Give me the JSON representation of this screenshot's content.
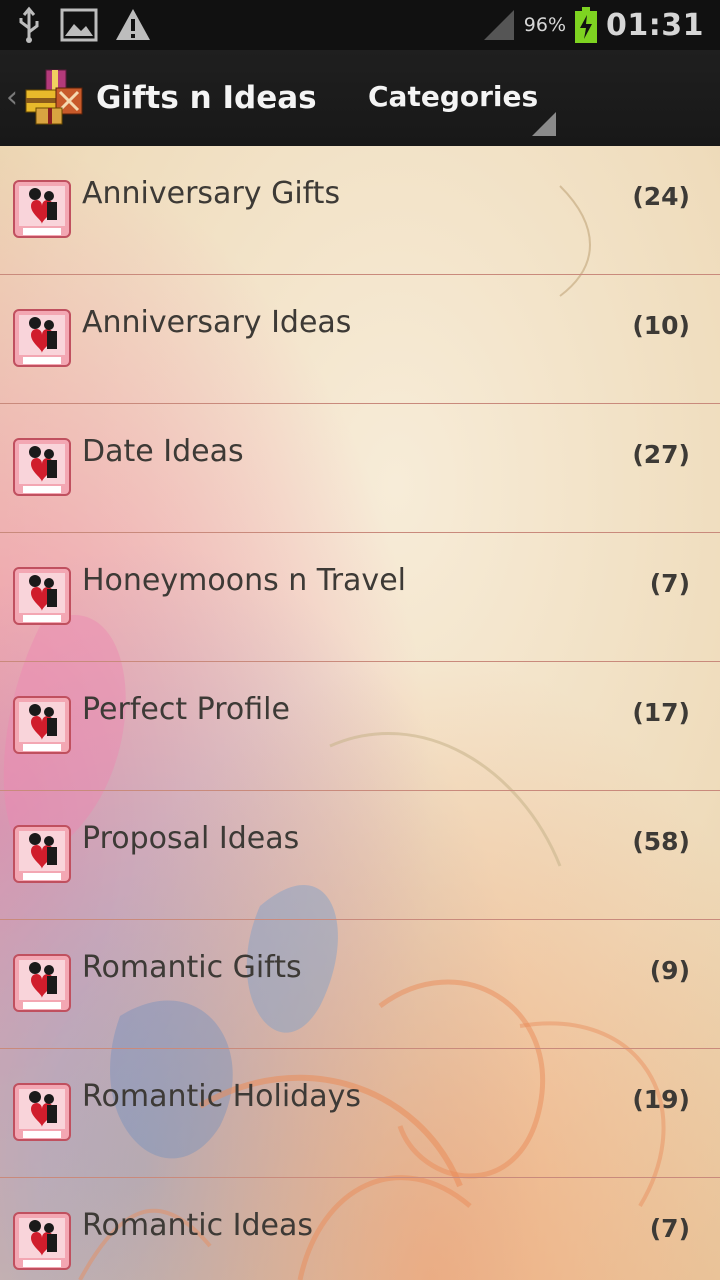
{
  "status_bar": {
    "battery_percent": "96%",
    "time": "01:31",
    "left_icons": [
      "usb-icon",
      "image-icon",
      "warning-icon"
    ],
    "right_icons": [
      "signal-icon",
      "battery-charging-icon"
    ]
  },
  "action_bar": {
    "app_title": "Gifts n Ideas",
    "spinner_label": "Categories"
  },
  "categories": [
    {
      "name": "Anniversary Gifts",
      "count": "(24)"
    },
    {
      "name": "Anniversary Ideas",
      "count": "(10)"
    },
    {
      "name": "Date Ideas",
      "count": "(27)"
    },
    {
      "name": "Honeymoons n Travel",
      "count": "(7)"
    },
    {
      "name": "Perfect Profile",
      "count": "(17)"
    },
    {
      "name": "Proposal Ideas",
      "count": "(58)"
    },
    {
      "name": "Romantic Gifts",
      "count": "(9)"
    },
    {
      "name": "Romantic Holidays",
      "count": "(19)"
    },
    {
      "name": "Romantic Ideas",
      "count": "(7)"
    }
  ],
  "colors": {
    "status_bar_bg": "#111111",
    "action_bar_bg": "#1c1c1c",
    "list_text": "#3d3a36",
    "divider": "#c98a7c",
    "paper_bg": "#f3e6cf",
    "battery_green": "#7ed321"
  }
}
